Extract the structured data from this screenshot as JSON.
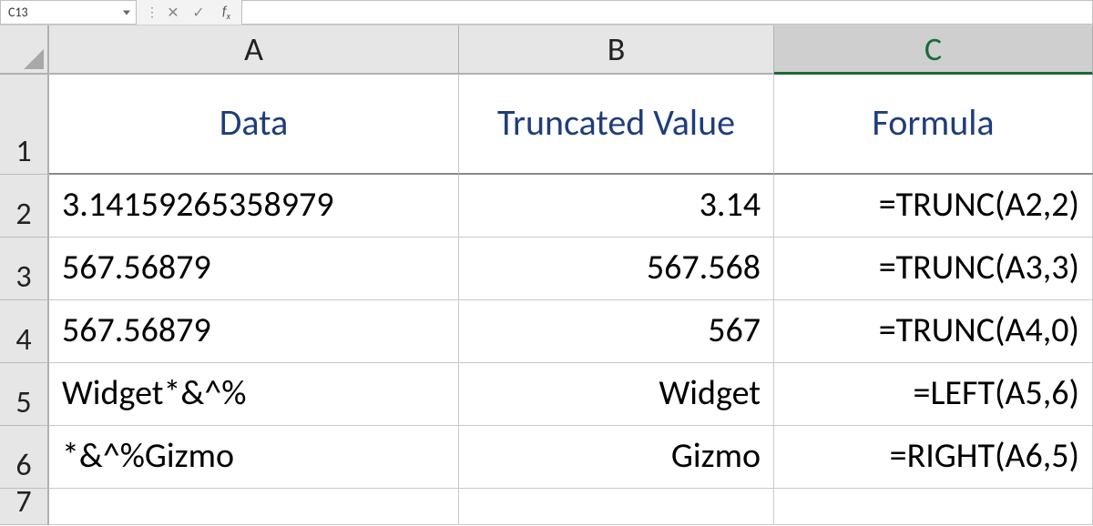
{
  "formula_bar": {
    "name_box": "C13",
    "cancel_glyph": "✕",
    "enter_glyph": "✓",
    "fx_label": "fx",
    "formula_value": ""
  },
  "columns": [
    "A",
    "B",
    "C"
  ],
  "active_column_index": 2,
  "row_numbers": [
    "1",
    "2",
    "3",
    "4",
    "5",
    "6",
    "7"
  ],
  "headers": {
    "A": "Data",
    "B": "Truncated Value",
    "C": "Formula"
  },
  "rows": [
    {
      "A": "3.14159265358979",
      "B": "3.14",
      "C": "=TRUNC(A2,2)"
    },
    {
      "A": "567.56879",
      "B": "567.568",
      "C": "=TRUNC(A3,3)"
    },
    {
      "A": "567.56879",
      "B": "567",
      "C": "=TRUNC(A4,0)"
    },
    {
      "A": "Widget*&^%",
      "B": "Widget",
      "C": "=LEFT(A5,6)"
    },
    {
      "A": "*&^%Gizmo",
      "B": "Gizmo",
      "C": "=RIGHT(A6,5)"
    }
  ]
}
